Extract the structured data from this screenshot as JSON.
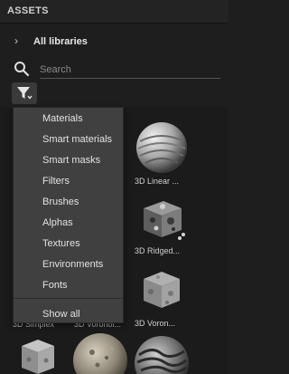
{
  "panel": {
    "title": "ASSETS"
  },
  "libraries": {
    "label": "All libraries"
  },
  "search": {
    "placeholder": "Search"
  },
  "filter_menu": {
    "items": [
      "Materials",
      "Smart materials",
      "Smart masks",
      "Filters",
      "Brushes",
      "Alphas",
      "Textures",
      "Environments",
      "Fonts"
    ],
    "show_all": "Show all"
  },
  "assets": [
    {
      "caption": "3D Linear ..."
    },
    {
      "caption": "3D Ridged..."
    },
    {
      "caption": "3D Voron..."
    },
    {
      "caption": "3D Voronoi..."
    }
  ],
  "colors": {
    "background": "#1e1e1e",
    "menu": "#404040",
    "text": "#d6d6d6"
  }
}
